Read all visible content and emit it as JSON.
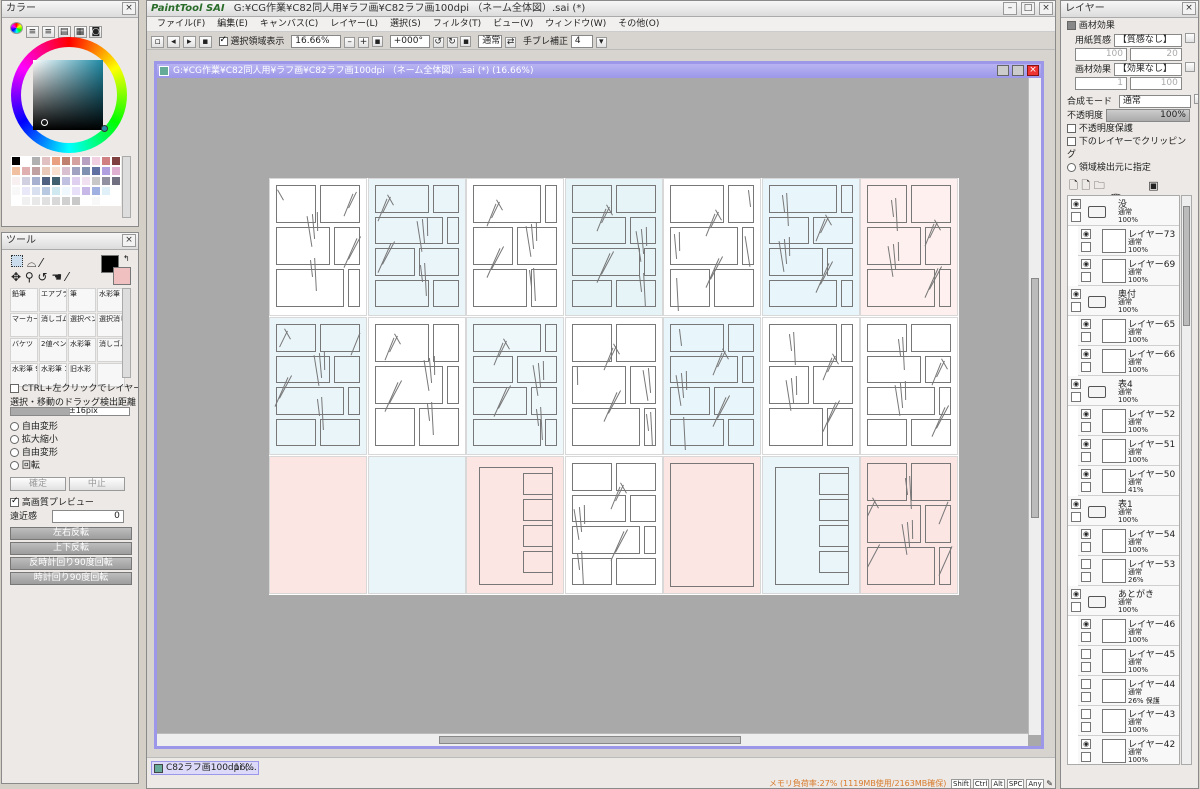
{
  "color_panel": {
    "title": "カラー",
    "close": "×",
    "swatch_colors": [
      "#000000",
      "#ffffff",
      "#b0b0b0",
      "#e0c0c0",
      "#e8a080",
      "#c08070",
      "#d4a0a0",
      "#b8a0c0",
      "#f0d0e0",
      "#d08080",
      "#804040",
      "#f0c0a0",
      "#e0b0b0",
      "#c0a0a0",
      "#e8c8b8",
      "#f8e0d0",
      "#d8c0d0",
      "#a0a0c0",
      "#8090b0",
      "#6070a0",
      "#b0a0e0",
      "#e0b0d0",
      "#f8f0f0",
      "#d0d0e0",
      "#a8b0d0",
      "#506080",
      "#406070",
      "#c0c0e0",
      "#e0d0f0",
      "#f0e0f0",
      "#c8c8c8",
      "#9090a0",
      "#707080",
      "#f8f8f8",
      "#e8e8f8",
      "#d8e0f0",
      "#b8c8e0",
      "#d0e8f0",
      "#f0f8ff",
      "#e8e0f8",
      "#c8b8e8",
      "#a0b0e0",
      "#e0f0f8",
      "#ffffff",
      "#ffffff",
      "#f0f0f0",
      "#e8e8e8",
      "#e0e0e0",
      "#d8d8d8",
      "#d0d0d0",
      "#c8c8c8",
      "#ffffff",
      "#f8f8f8",
      "#ffffff",
      "#ffffff"
    ]
  },
  "tool_panel": {
    "title": "ツール",
    "close": "×",
    "tools": [
      "鉛筆",
      "エアブラシ",
      "筆",
      "水彩筆",
      "マーカー",
      "消しゴム",
      "選択ペン",
      "選択消し",
      "バケツ",
      "2値ペン",
      "水彩筆",
      "消しゴム",
      "水彩筆 9筋",
      "水彩筆 10筋",
      "旧水彩",
      ""
    ],
    "ctrl_label": "CTRL+左クリックでレイヤー選択",
    "drag_label": "選択・移動のドラッグ検出距離",
    "drag_value": "±16pix",
    "transforms": [
      "自由変形",
      "拡大縮小",
      "自由変形",
      "回転"
    ],
    "confirm": "確定",
    "cancel": "中止",
    "preview_label": "高画質プレビュー",
    "perspective_label": "遠近感",
    "perspective_value": "0",
    "flip_h": "左右反転",
    "flip_v": "上下反転",
    "rotate_ccw": "反時計回り90度回転",
    "rotate_cw": "時計回り90度回転"
  },
  "main": {
    "app_logo": "PaintTool SAI",
    "title": "G:¥CG作業¥C82同人用¥ラフ画¥C82ラフ画100dpi （ネーム全体図）.sai (*)",
    "menus": [
      "ファイル(F)",
      "編集(E)",
      "キャンバス(C)",
      "レイヤー(L)",
      "選択(S)",
      "フィルタ(T)",
      "ビュー(V)",
      "ウィンドウ(W)",
      "その他(O)"
    ],
    "toolbar": {
      "selection_label": "選択領域表示",
      "zoom": "16.66%",
      "angle": "+000°",
      "blend": "通常",
      "stabilizer_label": "手ブレ補正",
      "stabilizer_value": "4"
    },
    "canvas_title": "G:¥CG作業¥C82同人用¥ラフ画¥C82ラフ画100dpi （ネーム全体図）.sai (*) (16.66%)",
    "tab_label": "C82ラフ画100dpi (...",
    "tab_zoom": "16%",
    "status": "メモリ負荷率:27% (1119MB使用/2163MB確保)",
    "status_keys": [
      "Shift",
      "Ctrl",
      "Alt",
      "SPC",
      "Any"
    ]
  },
  "layer_panel": {
    "title": "レイヤー",
    "effects_title": "画材効果",
    "paper_label": "用紙質感",
    "paper_value": "【質感なし】",
    "paper_scale": "100",
    "paper_strength": "20",
    "brush_label": "画材効果",
    "brush_value": "【効果なし】",
    "brush_scale": "1",
    "brush_strength": "100",
    "blend_label": "合成モード",
    "blend_value": "通常",
    "opacity_label": "不透明度",
    "opacity_value": "100%",
    "opt_protect": "不透明度保護",
    "opt_clip": "下のレイヤーでクリッピング",
    "opt_source": "領域検出元に指定",
    "layers": [
      {
        "name": "没",
        "mode": "通常",
        "op": "100%",
        "folder": true,
        "child": false,
        "eye": true
      },
      {
        "name": "レイヤー73",
        "mode": "通常",
        "op": "100%",
        "folder": false,
        "child": true,
        "eye": true
      },
      {
        "name": "レイヤー69",
        "mode": "通常",
        "op": "100%",
        "folder": false,
        "child": true,
        "eye": true
      },
      {
        "name": "奥付",
        "mode": "通常",
        "op": "100%",
        "folder": true,
        "child": false,
        "eye": true
      },
      {
        "name": "レイヤー65",
        "mode": "通常",
        "op": "100%",
        "folder": false,
        "child": true,
        "eye": true
      },
      {
        "name": "レイヤー66",
        "mode": "通常",
        "op": "100%",
        "folder": false,
        "child": true,
        "eye": true
      },
      {
        "name": "表4",
        "mode": "通常",
        "op": "100%",
        "folder": true,
        "child": false,
        "eye": true
      },
      {
        "name": "レイヤー52",
        "mode": "通常",
        "op": "100%",
        "folder": false,
        "child": true,
        "eye": true
      },
      {
        "name": "レイヤー51",
        "mode": "通常",
        "op": "100%",
        "folder": false,
        "child": true,
        "eye": true
      },
      {
        "name": "レイヤー50",
        "mode": "通常",
        "op": "41%",
        "folder": false,
        "child": true,
        "eye": true
      },
      {
        "name": "表1",
        "mode": "通常",
        "op": "100%",
        "folder": true,
        "child": false,
        "eye": true
      },
      {
        "name": "レイヤー54",
        "mode": "通常",
        "op": "100%",
        "folder": false,
        "child": true,
        "eye": true
      },
      {
        "name": "レイヤー53",
        "mode": "通常",
        "op": "26%",
        "folder": false,
        "child": true,
        "eye": false
      },
      {
        "name": "あとがき",
        "mode": "通常",
        "op": "100%",
        "folder": true,
        "child": false,
        "eye": true
      },
      {
        "name": "レイヤー46",
        "mode": "通常",
        "op": "100%",
        "folder": false,
        "child": true,
        "eye": true
      },
      {
        "name": "レイヤー45",
        "mode": "通常",
        "op": "100%",
        "folder": false,
        "child": true,
        "eye": false
      },
      {
        "name": "レイヤー44",
        "mode": "通常",
        "op": "26%  保護",
        "folder": false,
        "child": true,
        "eye": false
      },
      {
        "name": "レイヤー43",
        "mode": "通常",
        "op": "100%",
        "folder": false,
        "child": true,
        "eye": false
      },
      {
        "name": "レイヤー42",
        "mode": "通常",
        "op": "100%",
        "folder": false,
        "child": true,
        "eye": true
      }
    ]
  }
}
